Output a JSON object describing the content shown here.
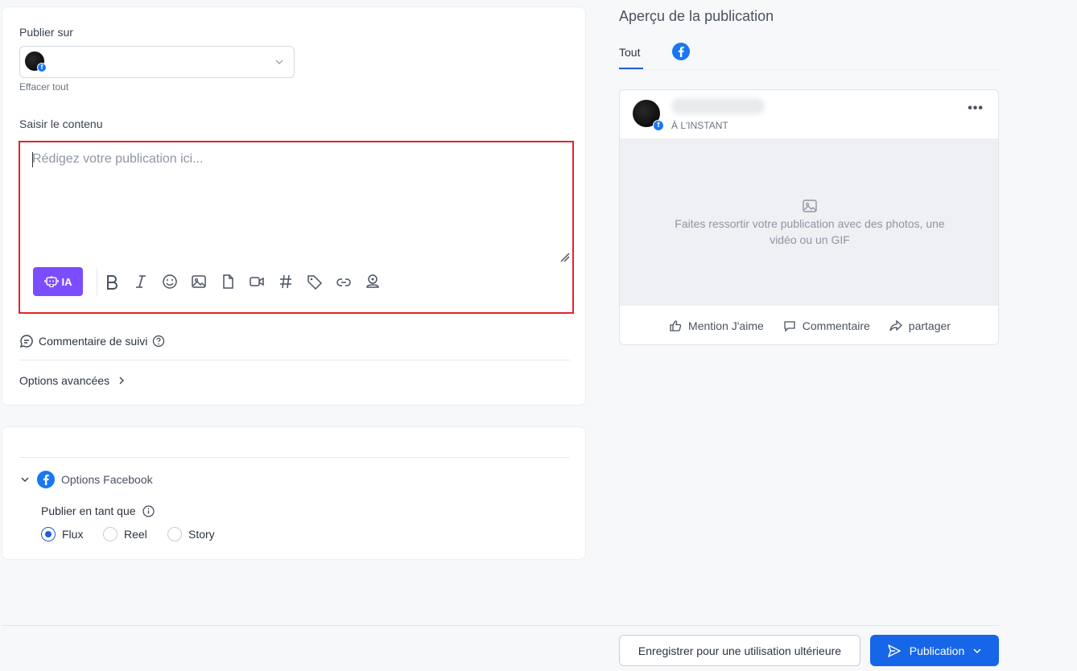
{
  "compose": {
    "publish_on_label": "Publier sur",
    "clear_all": "Effacer tout",
    "content_label": "Saisir le contenu",
    "placeholder": "Rédigez votre publication ici...",
    "ai_button": "IA",
    "toolbar_icons": [
      "bold-icon",
      "italic-icon",
      "emoji-icon",
      "image-icon",
      "file-icon",
      "video-icon",
      "hashtag-icon",
      "tag-icon",
      "link-icon",
      "location-icon"
    ],
    "follow_comment": "Commentaire de suivi",
    "advanced_options": "Options avancées"
  },
  "facebook_options": {
    "title": "Options Facebook",
    "publish_as_label": "Publier en tant que",
    "options": [
      "Flux",
      "Reel",
      "Story"
    ],
    "selected": "Flux"
  },
  "preview": {
    "title": "Aperçu de la publication",
    "tabs": [
      {
        "label": "Tout",
        "active": true
      },
      {
        "label": "facebook-icon",
        "active": false
      }
    ],
    "timestamp": "À L'INSTANT",
    "media_hint": "Faites ressortir votre publication avec des photos, une vidéo ou un GIF",
    "actions": {
      "like": "Mention J'aime",
      "comment": "Commentaire",
      "share": "partager"
    }
  },
  "footer": {
    "save_later": "Enregistrer pour une utilisation ultérieure",
    "publish": "Publication"
  },
  "colors": {
    "accent": "#1766e8",
    "ai": "#7c4dff",
    "facebook": "#1877f2",
    "editor_border": "#e0272b"
  }
}
